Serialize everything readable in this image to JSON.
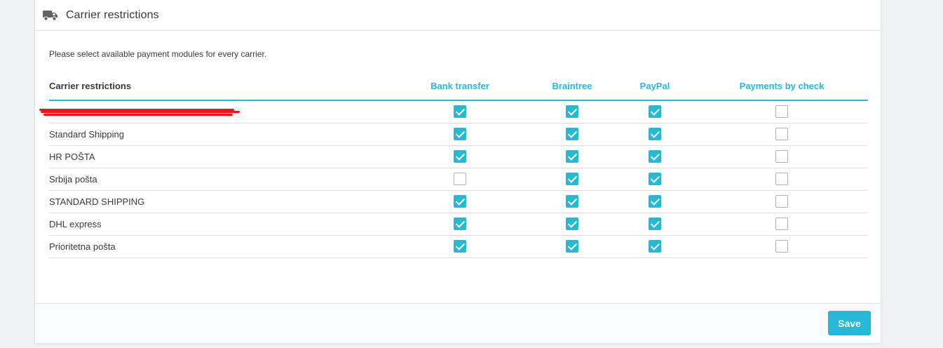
{
  "header": {
    "title": "Carrier restrictions",
    "icon": "truck-icon"
  },
  "hint": "Please select available payment modules for every carrier.",
  "table": {
    "carrier_header": "Carrier restrictions",
    "modules": [
      "Bank transfer",
      "Braintree",
      "PayPal",
      "Payments by check"
    ],
    "rows": [
      {
        "name": "",
        "redacted": true,
        "checks": [
          true,
          true,
          true,
          false
        ]
      },
      {
        "name": "Standard Shipping",
        "checks": [
          true,
          true,
          true,
          false
        ]
      },
      {
        "name": "HR POŠTA",
        "checks": [
          true,
          true,
          true,
          false
        ]
      },
      {
        "name": "Srbija pošta",
        "checks": [
          false,
          true,
          true,
          false
        ]
      },
      {
        "name": "STANDARD SHIPPING",
        "checks": [
          true,
          true,
          true,
          false
        ]
      },
      {
        "name": "DHL express",
        "checks": [
          true,
          true,
          true,
          false
        ]
      },
      {
        "name": "Prioritetna pošta",
        "checks": [
          true,
          true,
          true,
          false
        ]
      }
    ]
  },
  "footer": {
    "save_label": "Save"
  },
  "colors": {
    "accent": "#25b9d7",
    "redaction": "#f0131e"
  }
}
